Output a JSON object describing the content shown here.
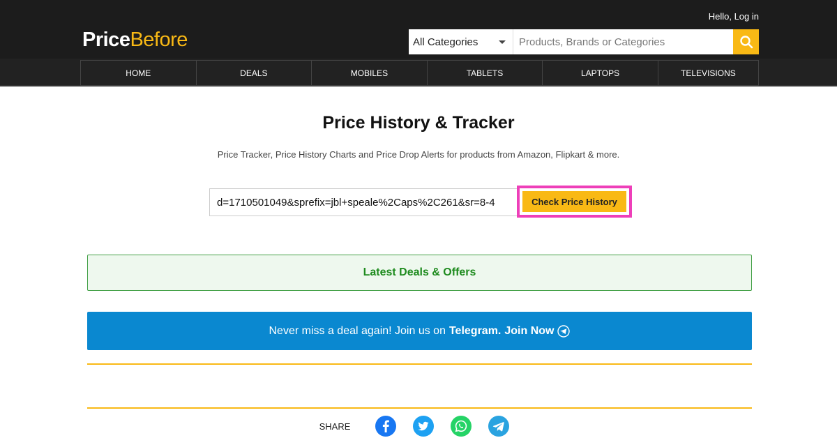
{
  "header": {
    "login_text": "Hello, Log in",
    "logo_part1": "Price",
    "logo_part2": "Before",
    "search": {
      "category_selected": "All Categories",
      "placeholder": "Products, Brands or Categories",
      "icon": "search-icon"
    }
  },
  "nav": {
    "items": [
      "HOME",
      "DEALS",
      "MOBILES",
      "TABLETS",
      "LAPTOPS",
      "TELEVISIONS"
    ]
  },
  "main": {
    "title": "Price History & Tracker",
    "subtitle": "Price Tracker, Price History Charts and Price Drop Alerts for products from Amazon, Flipkart & more.",
    "url_value": "d=1710501049&sprefix=jbl+speale%2Caps%2C261&sr=8-4",
    "check_button": "Check Price History",
    "deals_label": "Latest Deals & Offers",
    "telegram": {
      "text": "Never miss a deal again! Join us on",
      "strong": "Telegram.",
      "join": "Join Now"
    }
  },
  "share": {
    "label": "SHARE",
    "icons": [
      "facebook-icon",
      "twitter-icon",
      "whatsapp-icon",
      "telegram-icon"
    ]
  },
  "colors": {
    "accent": "#f9b915",
    "dark": "#1c1c1c",
    "highlight": "#ee3fb9",
    "deals_green": "#1e8b1e",
    "telegram_blue": "#0a88d0",
    "facebook": "#1877f2",
    "twitter": "#1da1f2",
    "whatsapp": "#25d366",
    "telegram": "#2aa3e0"
  }
}
